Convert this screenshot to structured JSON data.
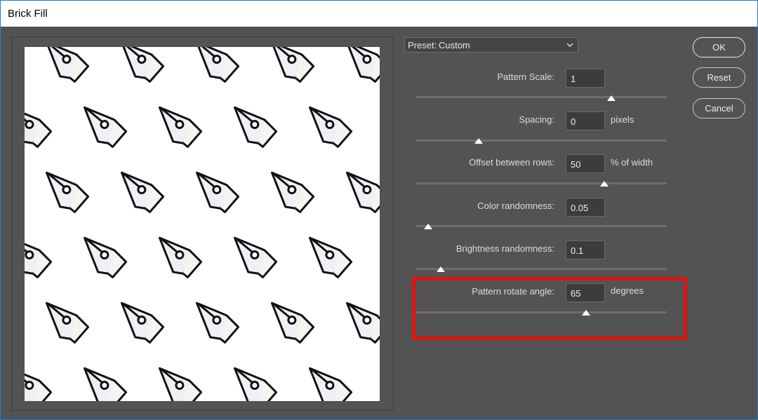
{
  "window": {
    "title": "Brick Fill"
  },
  "preset": {
    "prefix": "Preset:",
    "value": "Custom"
  },
  "params": [
    {
      "label": "Pattern Scale:",
      "value": "1",
      "unit": "",
      "slider_fraction": 0.78
    },
    {
      "label": "Spacing:",
      "value": "0",
      "unit": "pixels",
      "slider_fraction": 0.25
    },
    {
      "label": "Offset between rows:",
      "value": "50",
      "unit": "% of width",
      "slider_fraction": 0.75
    },
    {
      "label": "Color randomness:",
      "value": "0.05",
      "unit": "",
      "slider_fraction": 0.05
    },
    {
      "label": "Brightness randomness:",
      "value": "0.1",
      "unit": "",
      "slider_fraction": 0.1
    },
    {
      "label": "Pattern rotate angle:",
      "value": "65",
      "unit": "degrees",
      "slider_fraction": 0.68
    }
  ],
  "buttons": {
    "ok": "OK",
    "reset": "Reset",
    "cancel": "Cancel"
  },
  "colors": {
    "highlight": "#e0140f",
    "panel": "#535353",
    "accent_border": "#1b7fd4"
  },
  "icons": {
    "preview_tile": "pen-nib-icon",
    "dropdown": "chevron-down-icon"
  }
}
